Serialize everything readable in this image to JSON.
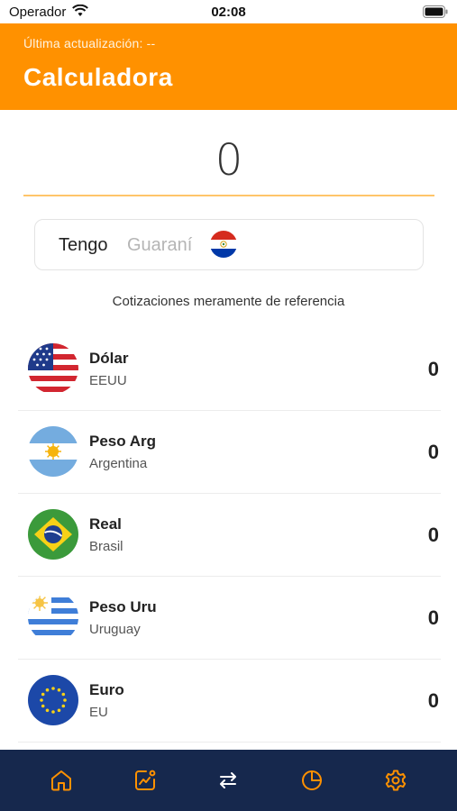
{
  "status_bar": {
    "carrier": "Operador",
    "time": "02:08"
  },
  "header": {
    "last_update": "Última actualización: --",
    "title": "Calculadora",
    "background_color": "#ff9100"
  },
  "amount": {
    "value": "0",
    "underline_color": "#ffc56a"
  },
  "tengo": {
    "label": "Tengo",
    "currency": "Guaraní",
    "flag_icon": "paraguay-flag-icon"
  },
  "disclaimer": "Cotizaciones meramente de referencia",
  "currencies": [
    {
      "name": "Dólar",
      "country": "EEUU",
      "value": "0",
      "flag_icon": "usa-flag-icon"
    },
    {
      "name": "Peso Arg",
      "country": "Argentina",
      "value": "0",
      "flag_icon": "argentina-flag-icon"
    },
    {
      "name": "Real",
      "country": "Brasil",
      "value": "0",
      "flag_icon": "brazil-flag-icon"
    },
    {
      "name": "Peso Uru",
      "country": "Uruguay",
      "value": "0",
      "flag_icon": "uruguay-flag-icon"
    },
    {
      "name": "Euro",
      "country": "EU",
      "value": "0",
      "flag_icon": "eu-flag-icon"
    }
  ],
  "bottom_nav": {
    "background_color": "#16284d",
    "icon_color": "#ff9100",
    "items": [
      {
        "icon": "home-icon"
      },
      {
        "icon": "chart-icon"
      },
      {
        "icon": "swap-icon"
      },
      {
        "icon": "pie-chart-icon"
      },
      {
        "icon": "settings-icon"
      }
    ]
  }
}
